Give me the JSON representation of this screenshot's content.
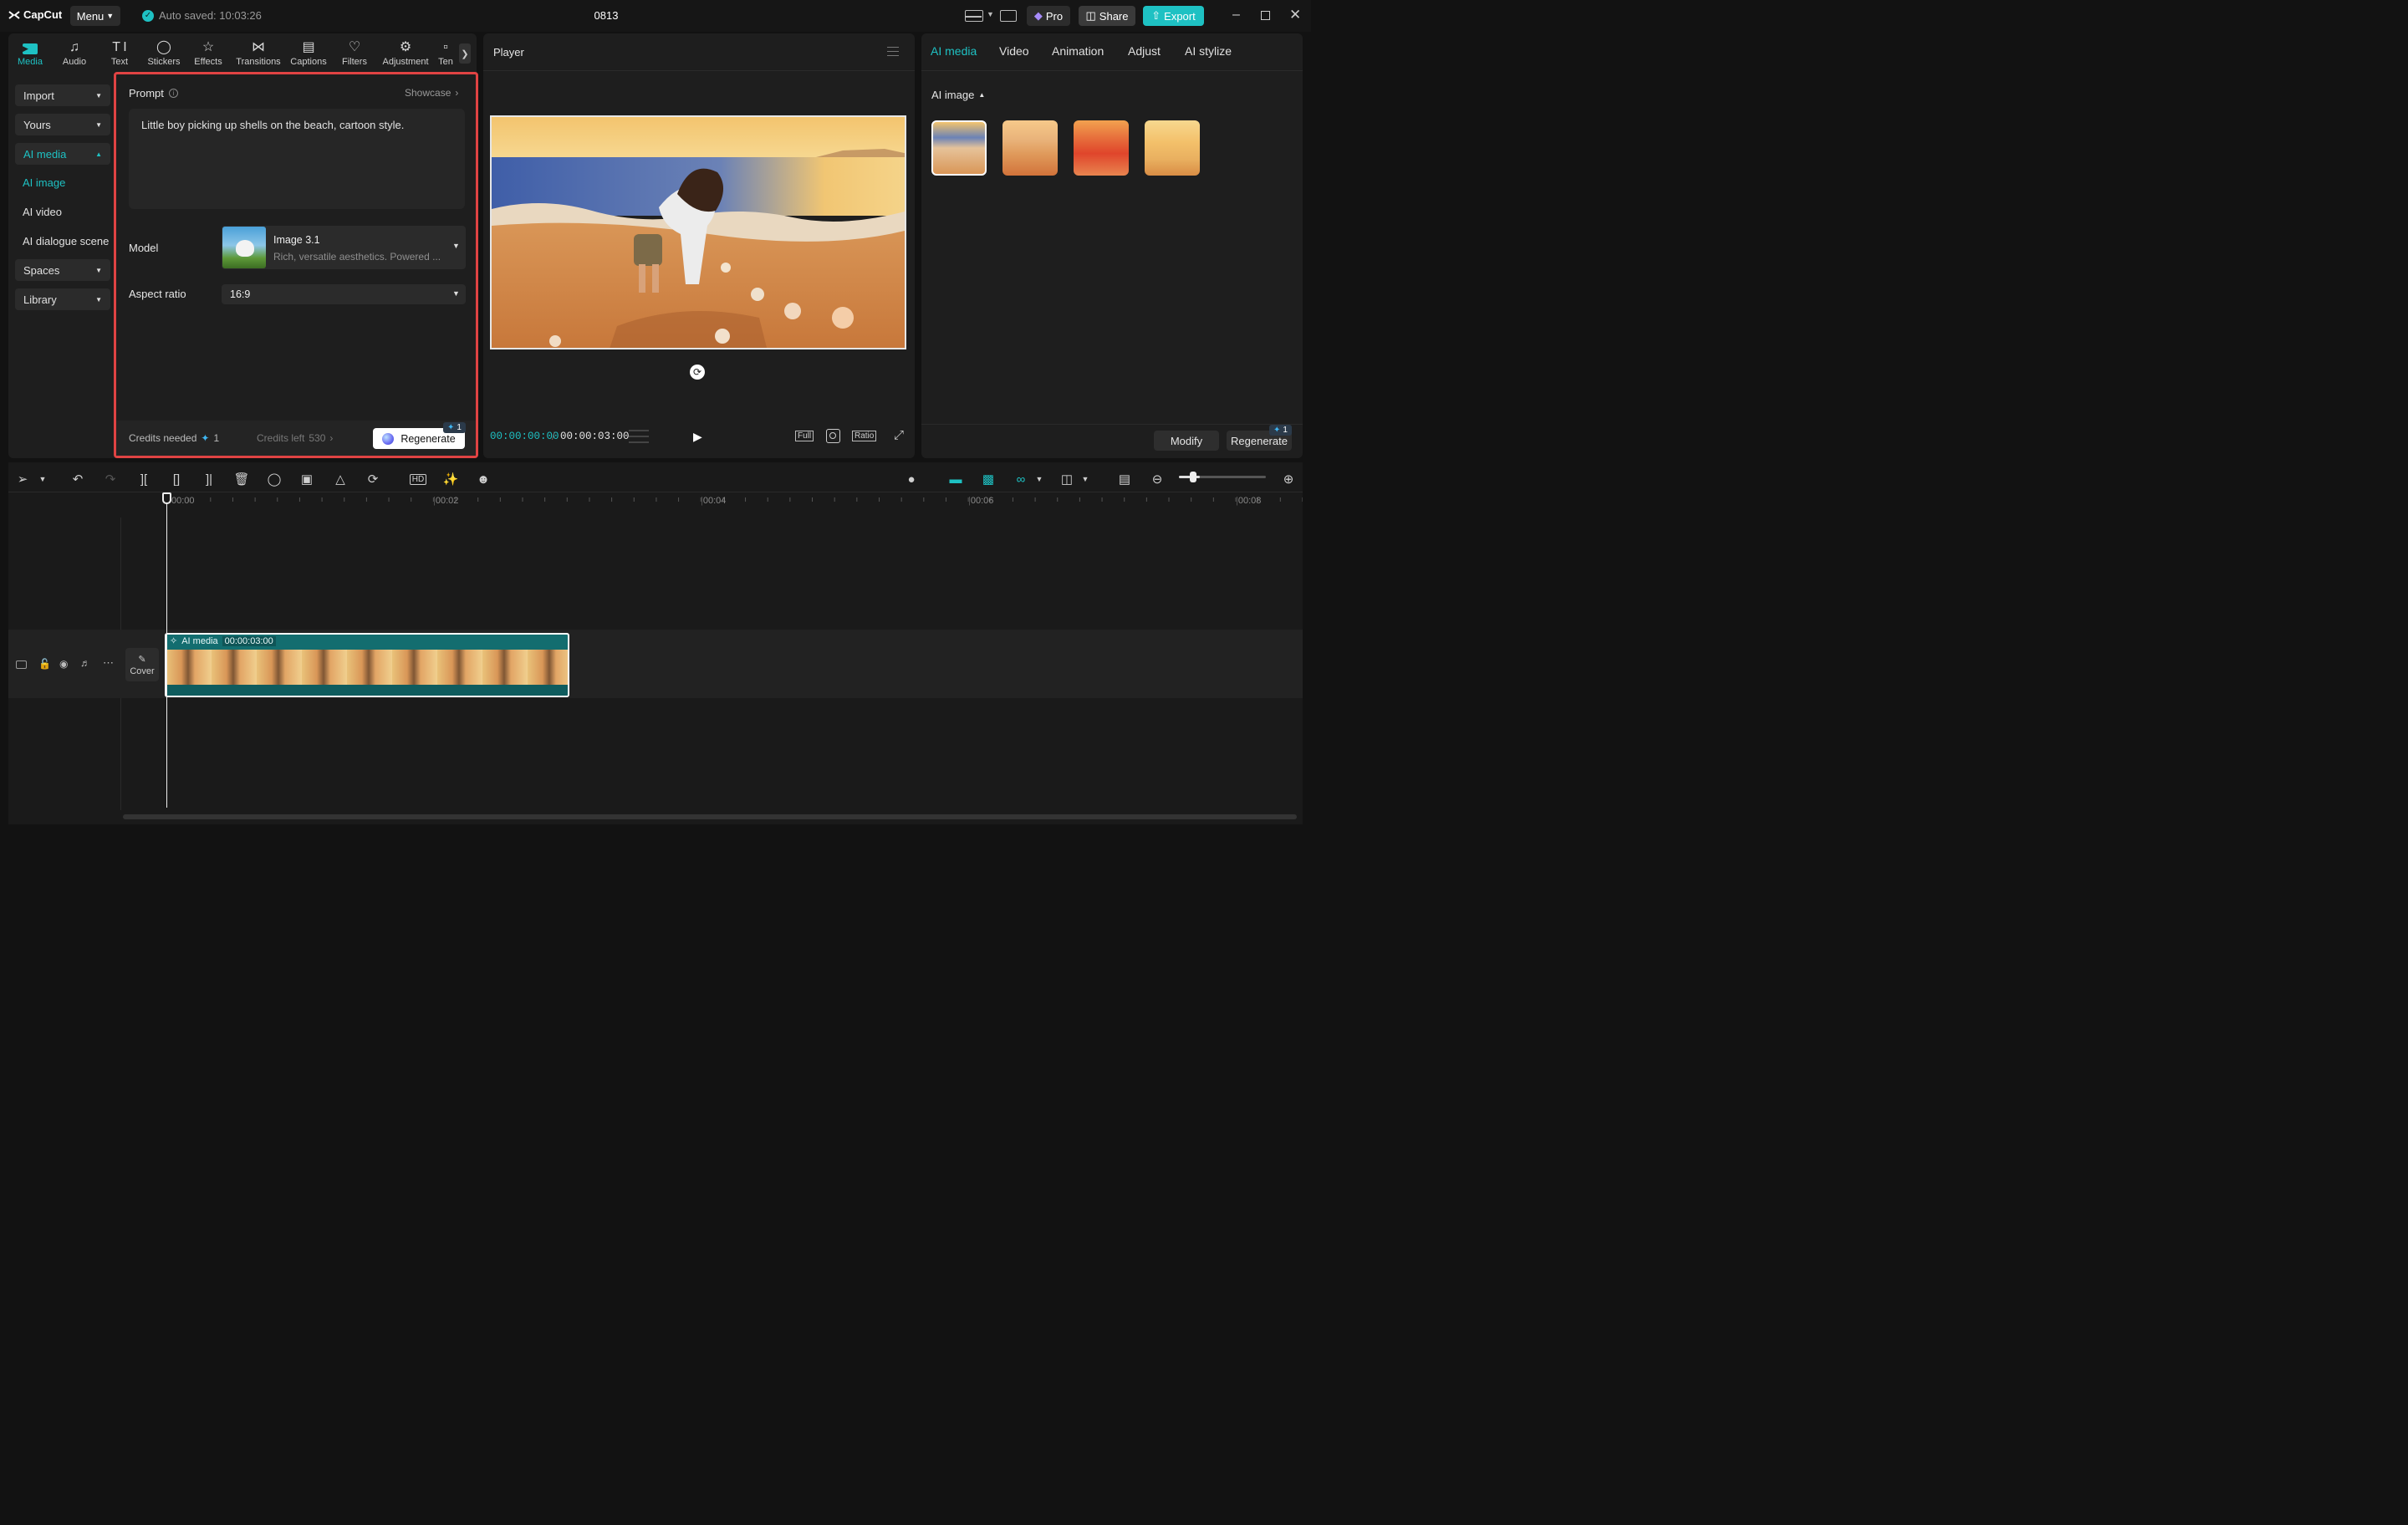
{
  "titlebar": {
    "logo": "CapCut",
    "menu_label": "Menu",
    "autosave": "Auto saved: 10:03:26",
    "project_name": "0813",
    "pro_label": "Pro",
    "share_label": "Share",
    "export_label": "Export"
  },
  "tools": [
    "Media",
    "Audio",
    "Text",
    "Stickers",
    "Effects",
    "Transitions",
    "Captions",
    "Filters",
    "Adjustment",
    "Ten"
  ],
  "sidebar": {
    "import": "Import",
    "yours": "Yours",
    "ai_media": "AI media",
    "ai_image": "AI image",
    "ai_video": "AI video",
    "ai_dialogue": "AI dialogue scene",
    "spaces": "Spaces",
    "library": "Library"
  },
  "prompt": {
    "label": "Prompt",
    "showcase": "Showcase",
    "text": "Little boy picking up shells on the beach, cartoon style.",
    "model_label": "Model",
    "model_name": "Image 3.1",
    "model_desc": "Rich, versatile aesthetics. Powered ...",
    "aspect_label": "Aspect ratio",
    "aspect_value": "16:9",
    "credits_needed": "Credits needed",
    "credits_needed_value": "1",
    "credits_left": "Credits left",
    "credits_left_value": "530",
    "regenerate": "Regenerate",
    "badge": "1"
  },
  "player": {
    "title": "Player",
    "time_current": "00:00:00:00",
    "time_total": "00:00:03:00",
    "full": "Full",
    "ratio": "Ratio"
  },
  "right": {
    "tabs": [
      "AI media",
      "Video",
      "Animation",
      "Adjust",
      "AI stylize"
    ],
    "section": "AI image",
    "modify": "Modify",
    "regenerate": "Regenerate",
    "badge": "1"
  },
  "timeline": {
    "ruler": [
      "00:00",
      "00:02",
      "00:04",
      "00:06",
      "00:08"
    ],
    "clip_label": "AI media",
    "clip_duration": "00:00:03:00",
    "cover": "Cover"
  },
  "colors": {
    "accent": "#1ec1c3",
    "highlight": "#e04343",
    "background": "#121212"
  }
}
